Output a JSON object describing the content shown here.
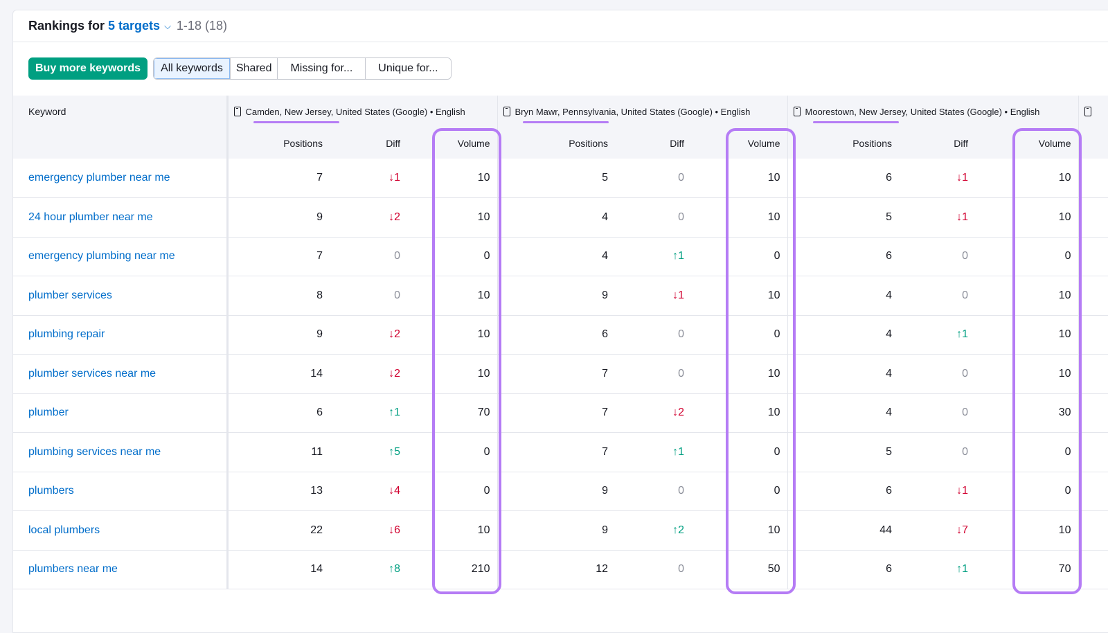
{
  "header": {
    "prefix": "Rankings for",
    "targets": "5 targets",
    "range": "1-18 (18)"
  },
  "toolbar": {
    "buy": "Buy more keywords",
    "filters": [
      "All keywords",
      "Shared",
      "Missing for...",
      "Unique for..."
    ]
  },
  "table": {
    "keyword_header": "Keyword",
    "locations": [
      "Camden, New Jersey, United States (Google) • English",
      "Bryn Mawr, Pennsylvania, United States (Google) • English",
      "Moorestown, New Jersey, United States (Google) • English"
    ],
    "subheaders": [
      "Positions",
      "Diff",
      "Volume"
    ],
    "highlight_color": "#b57cf5",
    "rows": [
      {
        "kw": "emergency plumber near me",
        "g": [
          [
            "7",
            "↓1",
            "10"
          ],
          [
            "5",
            "0",
            "10"
          ],
          [
            "6",
            "↓1",
            "10"
          ]
        ]
      },
      {
        "kw": "24 hour plumber near me",
        "g": [
          [
            "9",
            "↓2",
            "10"
          ],
          [
            "4",
            "0",
            "10"
          ],
          [
            "5",
            "↓1",
            "10"
          ]
        ]
      },
      {
        "kw": "emergency plumbing near me",
        "g": [
          [
            "7",
            "0",
            "0"
          ],
          [
            "4",
            "↑1",
            "0"
          ],
          [
            "6",
            "0",
            "0"
          ]
        ]
      },
      {
        "kw": "plumber services",
        "g": [
          [
            "8",
            "0",
            "10"
          ],
          [
            "9",
            "↓1",
            "10"
          ],
          [
            "4",
            "0",
            "10"
          ]
        ]
      },
      {
        "kw": "plumbing repair",
        "g": [
          [
            "9",
            "↓2",
            "10"
          ],
          [
            "6",
            "0",
            "0"
          ],
          [
            "4",
            "↑1",
            "10"
          ]
        ]
      },
      {
        "kw": "plumber services near me",
        "g": [
          [
            "14",
            "↓2",
            "10"
          ],
          [
            "7",
            "0",
            "10"
          ],
          [
            "4",
            "0",
            "10"
          ]
        ]
      },
      {
        "kw": "plumber",
        "g": [
          [
            "6",
            "↑1",
            "70"
          ],
          [
            "7",
            "↓2",
            "10"
          ],
          [
            "4",
            "0",
            "30"
          ]
        ]
      },
      {
        "kw": "plumbing services near me",
        "g": [
          [
            "11",
            "↑5",
            "0"
          ],
          [
            "7",
            "↑1",
            "0"
          ],
          [
            "5",
            "0",
            "0"
          ]
        ]
      },
      {
        "kw": "plumbers",
        "g": [
          [
            "13",
            "↓4",
            "0"
          ],
          [
            "9",
            "0",
            "0"
          ],
          [
            "6",
            "↓1",
            "0"
          ]
        ]
      },
      {
        "kw": "local plumbers",
        "g": [
          [
            "22",
            "↓6",
            "10"
          ],
          [
            "9",
            "↑2",
            "10"
          ],
          [
            "44",
            "↓7",
            "10"
          ]
        ]
      },
      {
        "kw": "plumbers near me",
        "g": [
          [
            "14",
            "↑8",
            "210"
          ],
          [
            "12",
            "0",
            "50"
          ],
          [
            "6",
            "↑1",
            "70"
          ]
        ]
      }
    ]
  }
}
